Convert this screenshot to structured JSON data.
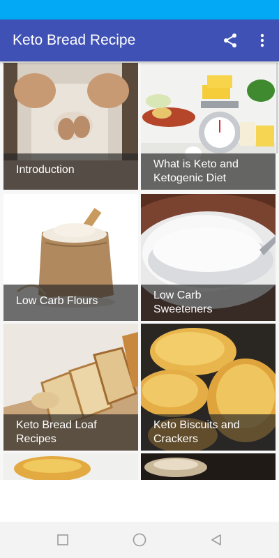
{
  "app": {
    "title": "Keto Bread Recipe"
  },
  "toolbar": {
    "share_icon": "share-icon",
    "more_icon": "more-vert-icon"
  },
  "colors": {
    "status_bar": "#03a9f4",
    "app_bar": "#3f51b5",
    "label_overlay": "rgba(40,40,40,0.68)"
  },
  "cards": [
    {
      "label": "Introduction"
    },
    {
      "label": "What is Keto and Ketogenic Diet"
    },
    {
      "label": "Low Carb Flours"
    },
    {
      "label": "Low Carb Sweeteners"
    },
    {
      "label": "Keto Bread Loaf Recipes"
    },
    {
      "label": "Keto Biscuits and Crackers"
    }
  ],
  "nav": {
    "recent_icon": "square-icon",
    "home_icon": "circle-icon",
    "back_icon": "triangle-back-icon"
  }
}
